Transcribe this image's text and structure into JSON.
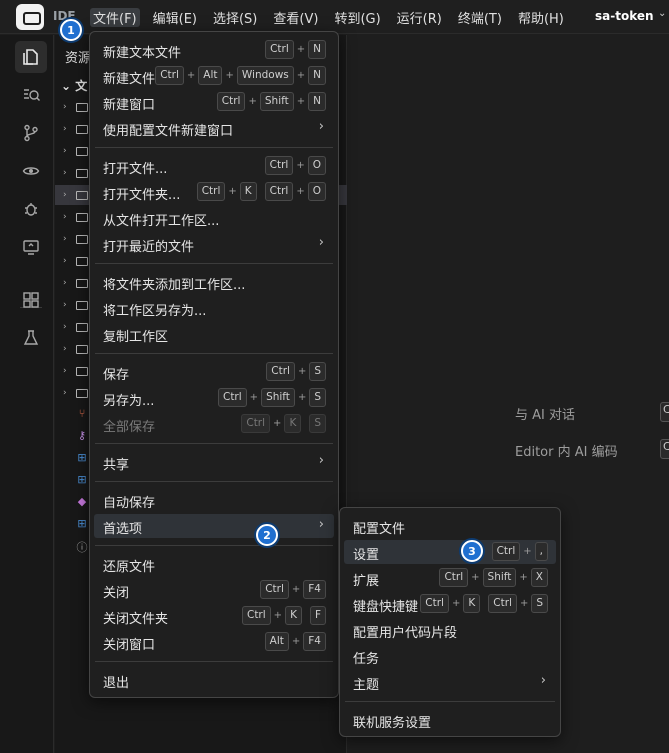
{
  "titlebar": {
    "ide_label": "IDE",
    "menus": [
      "文件(F)",
      "编辑(E)",
      "选择(S)",
      "查看(V)",
      "转到(G)",
      "运行(R)",
      "终端(T)",
      "帮助(H)"
    ],
    "project": "sa-token"
  },
  "badges": [
    "1",
    "2",
    "3"
  ],
  "sidebar": {
    "title": "资源",
    "section": "文"
  },
  "editor_hints": [
    {
      "label": "与 AI 对话",
      "key": "C"
    },
    {
      "label": "Editor 内 AI 编码",
      "key": "C"
    }
  ],
  "file_menu": [
    {
      "label": "新建文本文件",
      "keys": [
        [
          "Ctrl",
          "N"
        ]
      ]
    },
    {
      "label": "新建文件...",
      "keys": [
        [
          "Ctrl",
          "Alt",
          "Windows",
          "N"
        ]
      ]
    },
    {
      "label": "新建窗口",
      "keys": [
        [
          "Ctrl",
          "Shift",
          "N"
        ]
      ]
    },
    {
      "label": "使用配置文件新建窗口",
      "submenu": true
    },
    {
      "separator": true
    },
    {
      "label": "打开文件...",
      "keys": [
        [
          "Ctrl",
          "O"
        ]
      ]
    },
    {
      "label": "打开文件夹...",
      "keys": [
        [
          "Ctrl",
          "K"
        ],
        [
          "Ctrl",
          "O"
        ]
      ]
    },
    {
      "label": "从文件打开工作区..."
    },
    {
      "label": "打开最近的文件",
      "submenu": true
    },
    {
      "separator": true
    },
    {
      "label": "将文件夹添加到工作区..."
    },
    {
      "label": "将工作区另存为..."
    },
    {
      "label": "复制工作区"
    },
    {
      "separator": true
    },
    {
      "label": "保存",
      "keys": [
        [
          "Ctrl",
          "S"
        ]
      ]
    },
    {
      "label": "另存为...",
      "keys": [
        [
          "Ctrl",
          "Shift",
          "S"
        ]
      ]
    },
    {
      "label": "全部保存",
      "keys": [
        [
          "Ctrl",
          "K"
        ],
        [
          "S"
        ]
      ],
      "disabled": true
    },
    {
      "separator": true
    },
    {
      "label": "共享",
      "submenu": true
    },
    {
      "separator": true
    },
    {
      "label": "自动保存"
    },
    {
      "label": "首选项",
      "submenu": true,
      "highlighted": true
    },
    {
      "separator": true
    },
    {
      "label": "还原文件"
    },
    {
      "label": "关闭",
      "keys": [
        [
          "Ctrl",
          "F4"
        ]
      ]
    },
    {
      "label": "关闭文件夹",
      "keys": [
        [
          "Ctrl",
          "K"
        ],
        [
          "F"
        ]
      ]
    },
    {
      "label": "关闭窗口",
      "keys": [
        [
          "Alt",
          "F4"
        ]
      ]
    },
    {
      "separator": true
    },
    {
      "label": "退出"
    }
  ],
  "prefs_menu": [
    {
      "label": "配置文件"
    },
    {
      "label": "设置",
      "keys": [
        [
          "Ctrl",
          ","
        ]
      ],
      "highlighted": true
    },
    {
      "label": "扩展",
      "keys": [
        [
          "Ctrl",
          "Shift",
          "X"
        ]
      ]
    },
    {
      "label": "键盘快捷键",
      "keys": [
        [
          "Ctrl",
          "K"
        ],
        [
          "Ctrl",
          "S"
        ]
      ]
    },
    {
      "label": "配置用户代码片段"
    },
    {
      "label": "任务"
    },
    {
      "label": "主题",
      "submenu": true
    },
    {
      "separator": true
    },
    {
      "label": "联机服务设置"
    }
  ],
  "colors": {
    "accent_badge": "#1f6fd0",
    "menu_bg": "#1f1f1f",
    "highlight": "#2f3338"
  }
}
